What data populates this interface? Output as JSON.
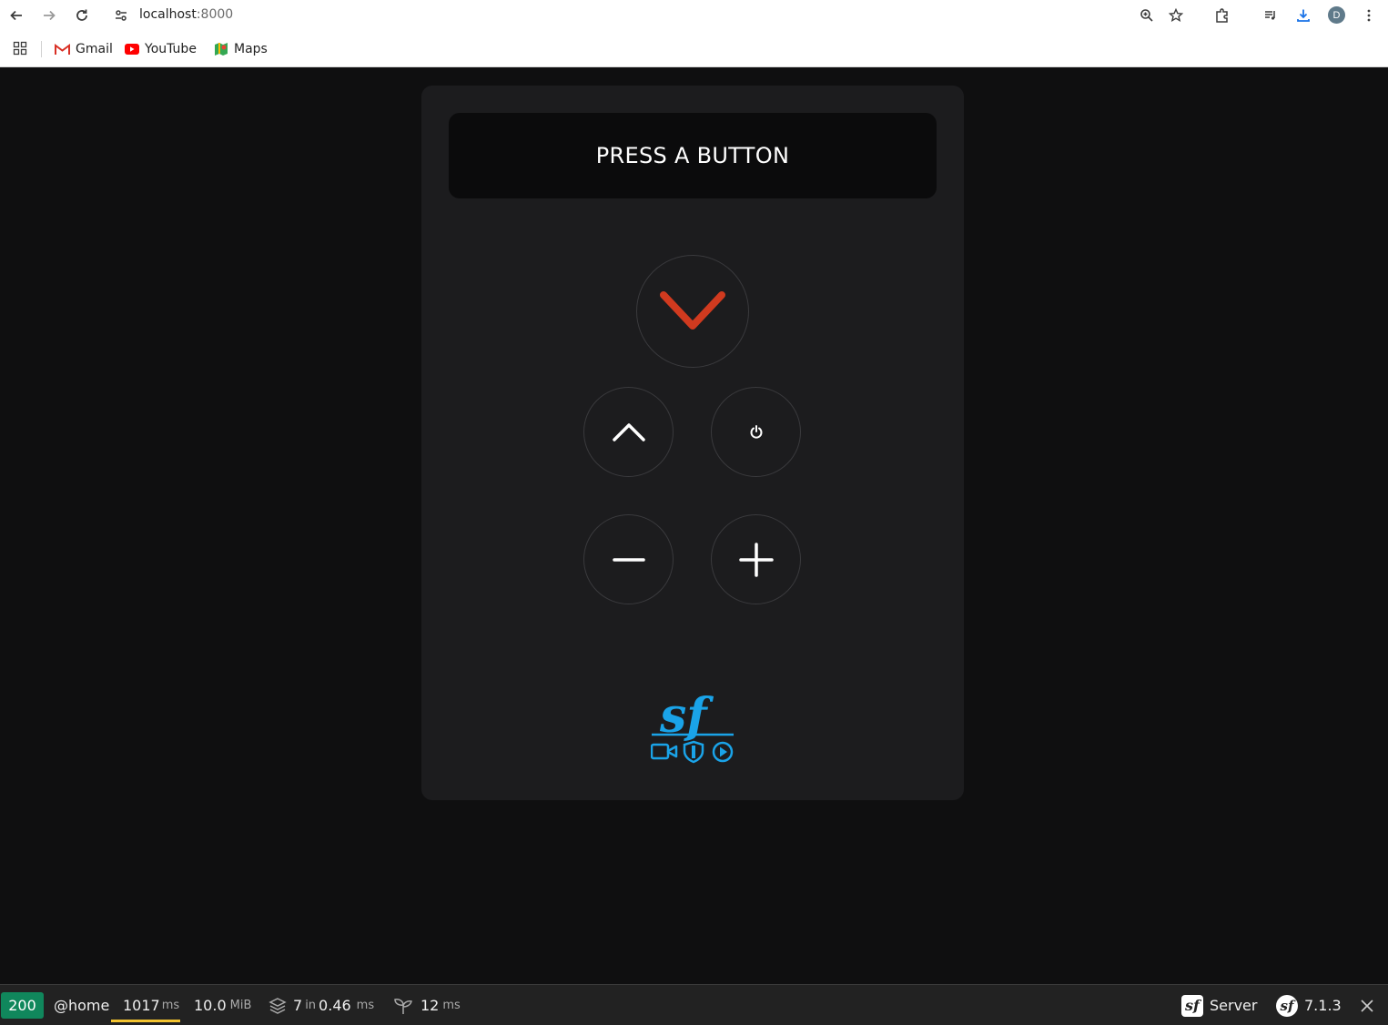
{
  "browser": {
    "url_host": "localhost",
    "url_port": ":8000",
    "profile_initial": "D",
    "bookmarks": [
      {
        "label": "Gmail",
        "icon": "gmail-icon"
      },
      {
        "label": "YouTube",
        "icon": "youtube-icon"
      },
      {
        "label": "Maps",
        "icon": "maps-icon"
      }
    ]
  },
  "remote": {
    "display_text": "PRESS A BUTTON",
    "buttons": [
      "chevron-down",
      "chevron-up",
      "power",
      "minus",
      "plus"
    ],
    "accent_color": "#d03a1f",
    "logo_color": "#1aa3e8"
  },
  "debug_toolbar": {
    "status_code": "200",
    "route": "@home",
    "time_value": "1017",
    "time_unit": "ms",
    "memory_value": "10.0",
    "memory_unit": "MiB",
    "cache_count": "7",
    "cache_in": "in",
    "cache_time": "0.46",
    "cache_unit": "ms",
    "twig_time": "12",
    "twig_unit": "ms",
    "server_label": "Server",
    "version": "7.1.3"
  }
}
